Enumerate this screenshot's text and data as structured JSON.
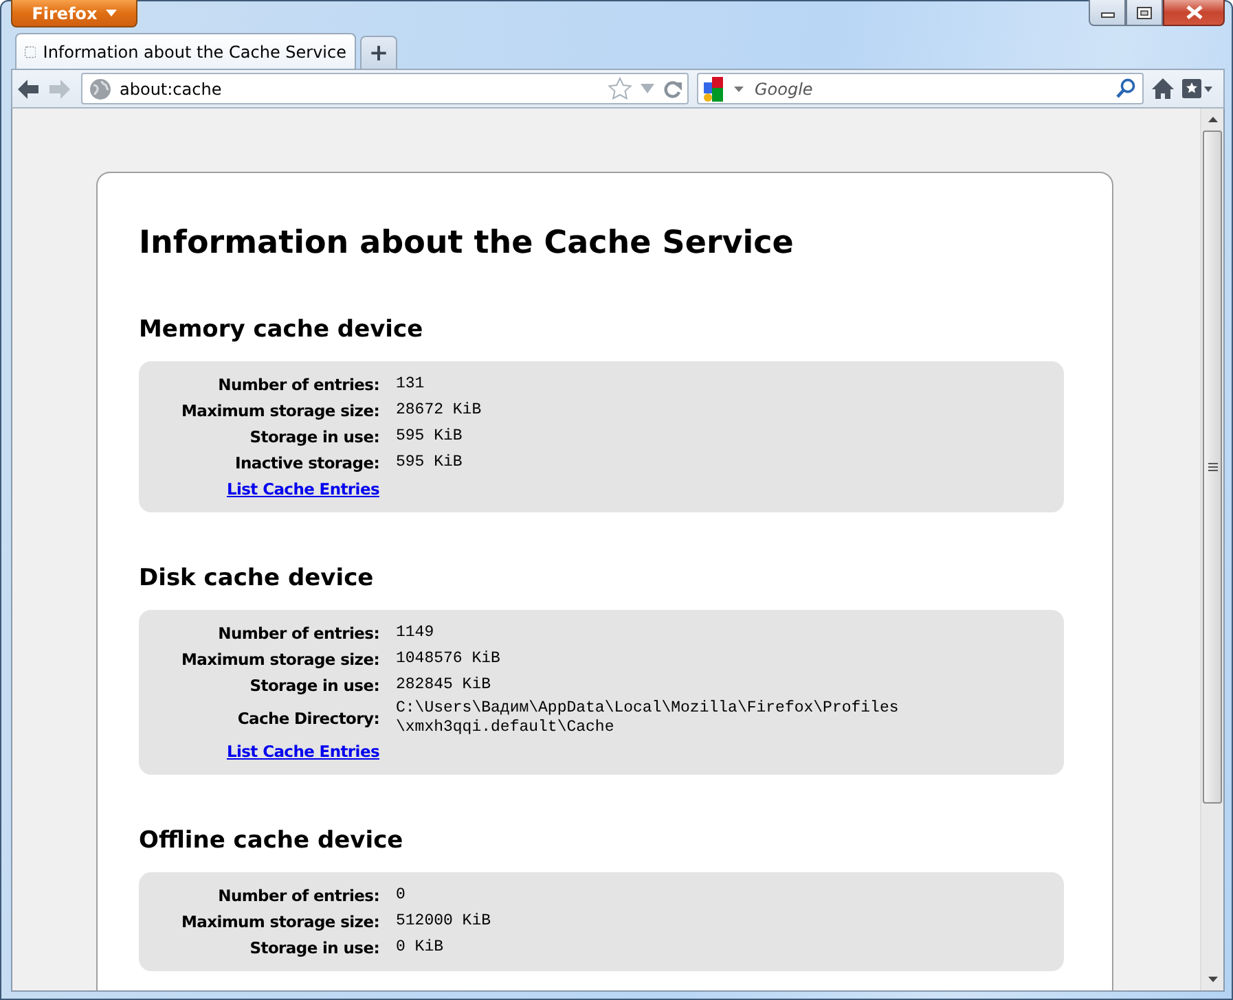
{
  "window": {
    "menu_button": "Firefox"
  },
  "tabs": [
    {
      "title": "Information about the Cache Service",
      "selected": true
    }
  ],
  "new_tab_button": "+",
  "navigation": {
    "back": {
      "disabled": false
    },
    "forward": {
      "disabled": true
    }
  },
  "address_bar": {
    "value": "about:cache"
  },
  "search_bar": {
    "placeholder": "Google"
  },
  "page": {
    "title": "Information about the Cache Service",
    "sections": [
      {
        "heading": "Memory cache device",
        "rows": [
          {
            "label": "Number of entries:",
            "value": "131"
          },
          {
            "label": "Maximum storage size:",
            "value": "28672 KiB"
          },
          {
            "label": "Storage in use:",
            "value": "595 KiB"
          },
          {
            "label": "Inactive storage:",
            "value": "595 KiB"
          }
        ],
        "link": "List Cache Entries"
      },
      {
        "heading": "Disk cache device",
        "rows": [
          {
            "label": "Number of entries:",
            "value": "1149"
          },
          {
            "label": "Maximum storage size:",
            "value": "1048576 KiB"
          },
          {
            "label": "Storage in use:",
            "value": "282845 KiB"
          },
          {
            "label": "Cache Directory:",
            "value": "C:\\Users\\Вадим\\AppData\\Local\\Mozilla\\Firefox\\Profiles\\xmxh3qqi.default\\Cache"
          }
        ],
        "link": "List Cache Entries"
      },
      {
        "heading": "Offline cache device",
        "rows": [
          {
            "label": "Number of entries:",
            "value": "0"
          },
          {
            "label": "Maximum storage size:",
            "value": "512000 KiB"
          },
          {
            "label": "Storage in use:",
            "value": "0 KiB"
          }
        ]
      }
    ]
  }
}
